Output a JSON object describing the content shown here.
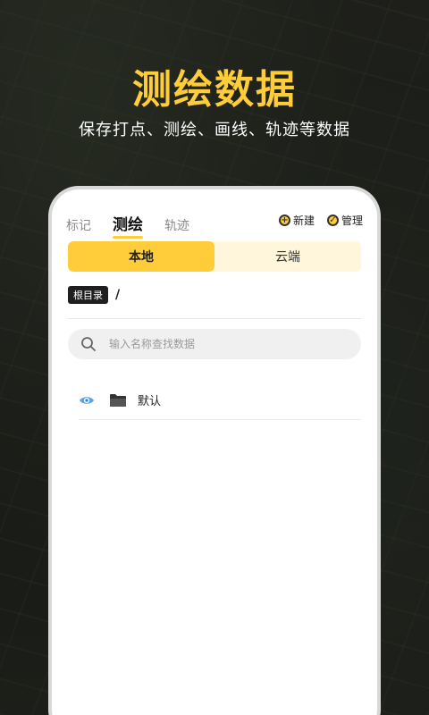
{
  "promo": {
    "headline": "测绘数据",
    "subline": "保存打点、测绘、画线、轨迹等数据"
  },
  "colors": {
    "accent": "#ffcd3a",
    "accent_light": "#fff6dc"
  },
  "header": {
    "tabs": [
      {
        "label": "标记",
        "active": false
      },
      {
        "label": "测绘",
        "active": true
      },
      {
        "label": "轨迹",
        "active": false
      }
    ],
    "actions": [
      {
        "label": "新建",
        "icon": "plus-circle-icon"
      },
      {
        "label": "管理",
        "icon": "check-circle-icon"
      }
    ]
  },
  "segment": {
    "options": [
      {
        "label": "本地",
        "active": true
      },
      {
        "label": "云端",
        "active": false
      }
    ]
  },
  "breadcrumb": {
    "root_label": "根目录",
    "separator": "/"
  },
  "search": {
    "placeholder": "输入名称查找数据",
    "value": ""
  },
  "list": {
    "items": [
      {
        "label": "默认",
        "visible_icon": "eye-icon",
        "type_icon": "folder-icon"
      }
    ]
  }
}
